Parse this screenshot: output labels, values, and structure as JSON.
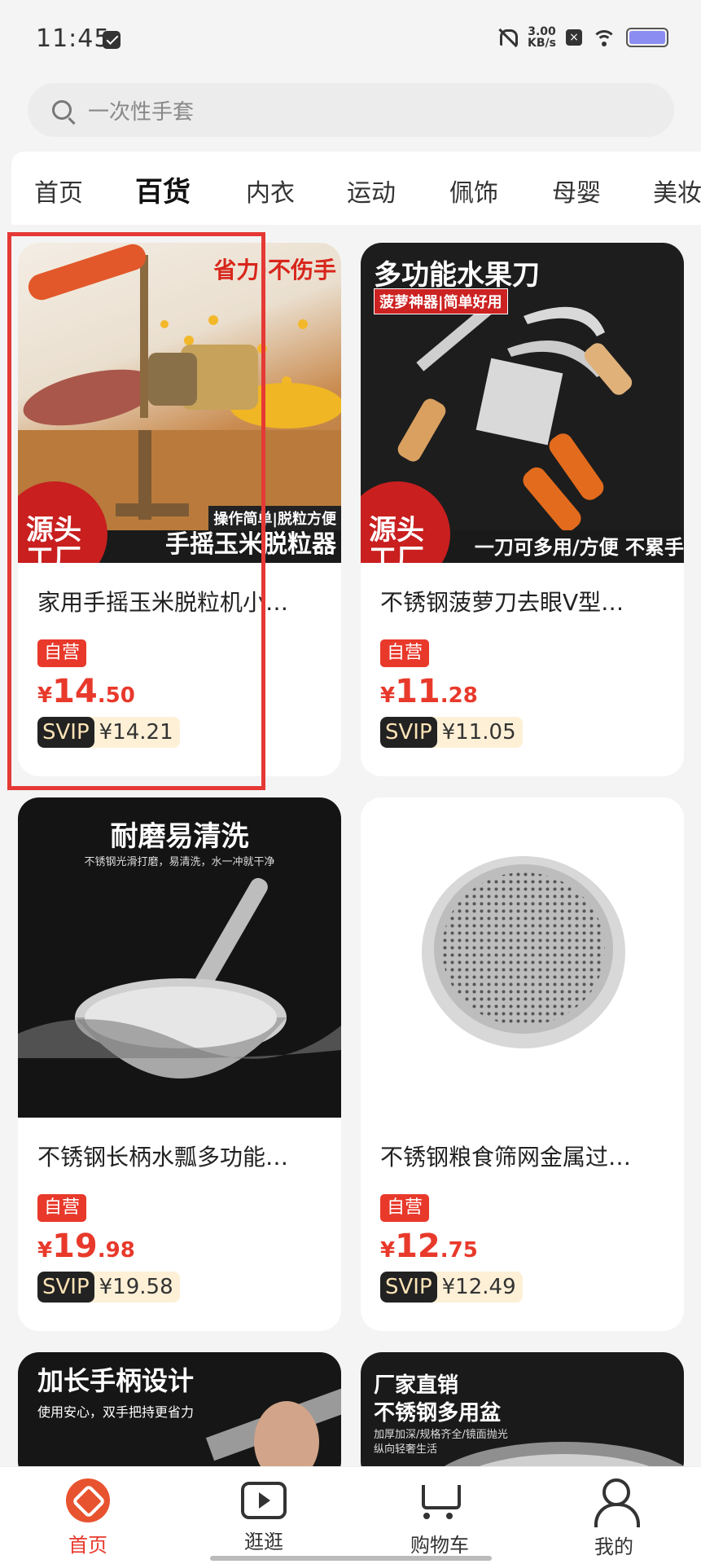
{
  "status": {
    "time": "11:45",
    "net_speed": "3.00",
    "net_unit": "KB/s"
  },
  "search": {
    "placeholder": "一次性手套"
  },
  "tabs": [
    "首页",
    "百货",
    "内衣",
    "运动",
    "佩饰",
    "母婴",
    "美妆"
  ],
  "products": [
    {
      "title": "家用手摇玉米脱粒机小…",
      "badge": "自营",
      "yen": "¥",
      "int": "14",
      "dec": ".50",
      "svip_label": "SVIP",
      "svip_price": "¥14.21",
      "img": {
        "top": "省力·不伤手",
        "sub": "操作简单|脱粒方便",
        "bottom": "手摇玉米脱粒器",
        "corner": "源头工厂"
      }
    },
    {
      "title": "不锈钢菠萝刀去眼V型…",
      "badge": "自营",
      "yen": "¥",
      "int": "11",
      "dec": ".28",
      "svip_label": "SVIP",
      "svip_price": "¥11.05",
      "img": {
        "top": "多功能水果刀",
        "sub": "菠萝神器|简单好用",
        "bottom": "一刀可多用/方便 不累手",
        "corner": "源头工厂"
      }
    },
    {
      "title": "不锈钢长柄水瓢多功能…",
      "badge": "自营",
      "yen": "¥",
      "int": "19",
      "dec": ".98",
      "svip_label": "SVIP",
      "svip_price": "¥19.58",
      "img": {
        "top": "耐磨易清洗",
        "sub": "不锈钢光滑打磨，易清洗，水一冲就干净"
      }
    },
    {
      "title": "不锈钢粮食筛网金属过…",
      "badge": "自营",
      "yen": "¥",
      "int": "12",
      "dec": ".75",
      "svip_label": "SVIP",
      "svip_price": "¥12.49"
    },
    {
      "img": {
        "top": "加长手柄设计",
        "sub": "使用安心，双手把持更省力"
      }
    },
    {
      "img": {
        "top": "厂家直销",
        "top2": "不锈钢多用盆",
        "sub": "加厚加深/规格齐全/镜面抛光",
        "sub2": "纵向轻奢生活"
      }
    }
  ],
  "bottom_nav": [
    "首页",
    "逛逛",
    "购物车",
    "我的"
  ]
}
